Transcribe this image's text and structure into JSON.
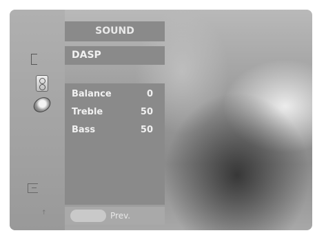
{
  "menu": {
    "title": "SOUND",
    "dasp_label": "DASP",
    "items": [
      {
        "label": "Balance",
        "value": "0"
      },
      {
        "label": "Treble",
        "value": "50"
      },
      {
        "label": "Bass",
        "value": "50"
      }
    ],
    "prev_label": "Prev."
  },
  "icons": [
    "bracket-icon",
    "speaker-icon",
    "disc-icon",
    "plug-icon",
    "arrow-icon"
  ],
  "colors": {
    "panel": "#8a8a8a",
    "bottom_bar": "#a9a9a9",
    "text": "#f1f1f1"
  }
}
